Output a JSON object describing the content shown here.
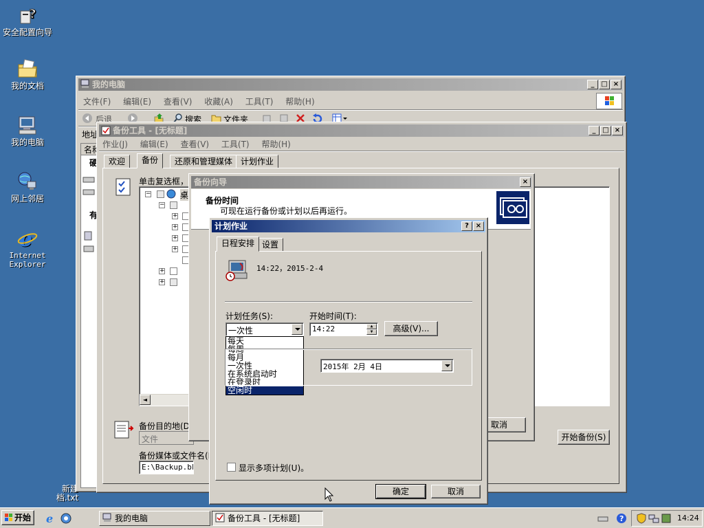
{
  "desktop": {
    "icons": [
      {
        "label": "安全配置向导"
      },
      {
        "label": "我的文档"
      },
      {
        "label": "我的电脑"
      },
      {
        "label": "网上邻居"
      },
      {
        "label": "Internet Explorer"
      },
      {
        "label": "新建\n档.txt"
      }
    ]
  },
  "explorer": {
    "title": "我的电脑",
    "menu": [
      "文件(F)",
      "编辑(E)",
      "查看(V)",
      "收藏(A)",
      "工具(T)",
      "帮助(H)"
    ],
    "toolbar": {
      "back": "后退",
      "search": "搜索",
      "folders": "文件夹"
    },
    "address_label": "地址",
    "side_label": "名称",
    "side_partial": [
      "硬",
      "有"
    ]
  },
  "backup": {
    "title": "备份工具 - [无标题]",
    "menu": [
      "作业(J)",
      "编辑(E)",
      "查看(V)",
      "工具(T)",
      "帮助(H)"
    ],
    "tabs": [
      "欢迎",
      "备份",
      "还原和管理媒体",
      "计划作业"
    ],
    "instruction": "单击复选框，选",
    "tree_root": "桌",
    "destination_label": "备份目的地(D)",
    "destination_value": "文件",
    "media_label": "备份媒体或文件名(M)",
    "media_value": "E:\\Backup.bkf",
    "start_button": "开始备份(S)"
  },
  "wizard": {
    "title": "备份向导",
    "heading": "备份时间",
    "subheading": "可现在运行备份或计划以后再运行。",
    "cancel_button": "取消"
  },
  "schedule": {
    "title": "计划作业",
    "help_button": "?",
    "tabs": [
      "日程安排",
      "设置"
    ],
    "summary": "14:22，2015-2-4",
    "task_label": "计划任务(S):",
    "task_value": "一次性",
    "task_options": [
      "每天",
      "每周",
      "每月",
      "一次性",
      "在系统启动时",
      "在登录时",
      "空闲时"
    ],
    "task_selected_index": 6,
    "start_time_label": "开始时间(T):",
    "start_time_value": "14:22",
    "advanced_button": "高级(V)...",
    "date_value": "2015年 2月 4日",
    "multi_label": "显示多项计划(U)。",
    "ok_button": "确定",
    "cancel_button": "取消"
  },
  "taskbar": {
    "start": "开始",
    "tasks": [
      {
        "label": "我的电脑"
      },
      {
        "label": "备份工具 - [无标题]"
      }
    ],
    "clock": "14:24"
  }
}
